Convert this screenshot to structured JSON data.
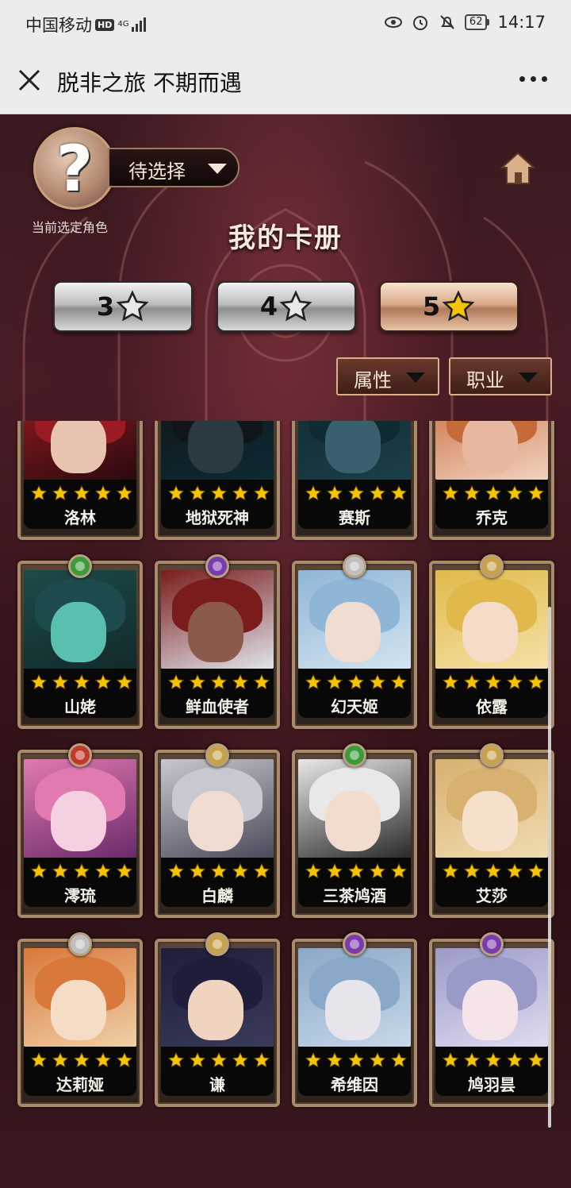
{
  "status_bar": {
    "carrier": "中国移动",
    "hd_badge": "HD",
    "network": "4G",
    "battery": "62",
    "time": "14:17",
    "icons": [
      "eye-icon",
      "alarm-icon",
      "mute-icon"
    ]
  },
  "title_bar": {
    "title": "脱非之旅 不期而遇",
    "close_icon": "close-icon",
    "more_icon": "more-icon"
  },
  "header": {
    "avatar_glyph": "?",
    "selector_label": "待选择",
    "avatar_caption": "当前选定角色",
    "home_icon": "home-icon"
  },
  "page_title": "我的卡册",
  "star_tabs": [
    {
      "label": "3",
      "active": false
    },
    {
      "label": "4",
      "active": false
    },
    {
      "label": "5",
      "active": true
    }
  ],
  "filters": [
    {
      "label": "属性"
    },
    {
      "label": "职业"
    }
  ],
  "cards": [
    {
      "name": "洛林",
      "stars": 5,
      "gem": "#c0392b",
      "palette": [
        "#9b1b22",
        "#2a0a0e",
        "#e8c4b0"
      ]
    },
    {
      "name": "地狱死神",
      "stars": 5,
      "gem": "#6a4aa0",
      "palette": [
        "#111418",
        "#0d2a33",
        "#2a3a40"
      ]
    },
    {
      "name": "赛斯",
      "stars": 5,
      "gem": "#6a4aa0",
      "palette": [
        "#0f2a30",
        "#1b3f48",
        "#3a6070"
      ]
    },
    {
      "name": "乔克",
      "stars": 5,
      "gem": "#c7a24a",
      "palette": [
        "#c76a3a",
        "#f2d2c0",
        "#e8b9a0"
      ]
    },
    {
      "name": "山姥",
      "stars": 5,
      "gem": "#3b9b3b",
      "palette": [
        "#1d4a4a",
        "#122a2a",
        "#5bbfb0"
      ]
    },
    {
      "name": "鲜血使者",
      "stars": 5,
      "gem": "#7a3ab0",
      "palette": [
        "#7a1c1c",
        "#e0e4ea",
        "#8a5a4a"
      ]
    },
    {
      "name": "幻天姬",
      "stars": 5,
      "gem": "#bfbfbf",
      "palette": [
        "#8fb6d6",
        "#d4e4f0",
        "#f0dcd0"
      ]
    },
    {
      "name": "依露",
      "stars": 5,
      "gem": "#c7a24a",
      "palette": [
        "#e0b94a",
        "#f5e2a8",
        "#f5dcc8"
      ]
    },
    {
      "name": "澪琉",
      "stars": 5,
      "gem": "#c0392b",
      "palette": [
        "#e07ab0",
        "#6a2a6a",
        "#f5d0e0"
      ]
    },
    {
      "name": "白麟",
      "stars": 5,
      "gem": "#c7a24a",
      "palette": [
        "#c8c8d0",
        "#4a4a5a",
        "#f0dcd0"
      ]
    },
    {
      "name": "三茶鸠酒",
      "stars": 5,
      "gem": "#3b9b3b",
      "palette": [
        "#e8e8e8",
        "#2a2a2a",
        "#f2dcd0"
      ]
    },
    {
      "name": "艾莎",
      "stars": 5,
      "gem": "#c7a24a",
      "palette": [
        "#d8b070",
        "#f0dcb0",
        "#f5e0cc"
      ]
    },
    {
      "name": "达莉娅",
      "stars": 5,
      "gem": "#bfbfbf",
      "palette": [
        "#d8783a",
        "#f0d0a8",
        "#f5dcc4"
      ]
    },
    {
      "name": "谦",
      "stars": 5,
      "gem": "#c7a24a",
      "palette": [
        "#1e1e3a",
        "#3a3a5a",
        "#f0d4c0"
      ]
    },
    {
      "name": "希维因",
      "stars": 5,
      "gem": "#7a3ab0",
      "palette": [
        "#8aa8c8",
        "#c8d8e8",
        "#e8e4ec"
      ]
    },
    {
      "name": "鸠羽昙",
      "stars": 5,
      "gem": "#7a3ab0",
      "palette": [
        "#9a9ac8",
        "#e0dcf0",
        "#f5e4e8"
      ]
    }
  ]
}
